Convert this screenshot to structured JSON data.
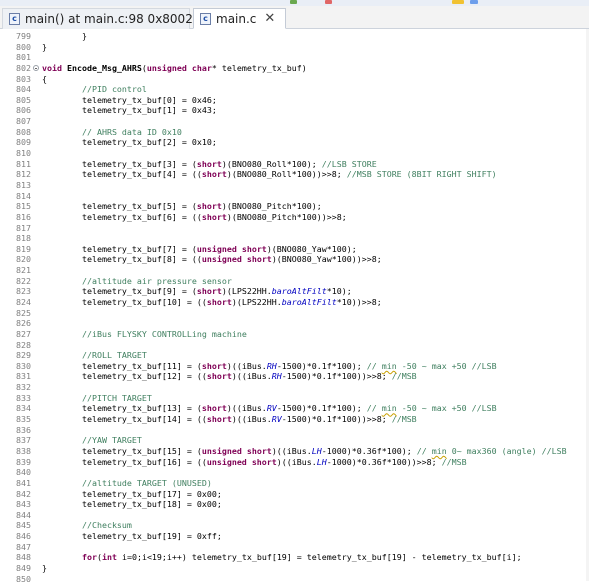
{
  "tabs": [
    {
      "label": "main() at main.c:98 0x8002222",
      "icon": "c-source-file-icon",
      "icon_text": "c",
      "active": false
    },
    {
      "label": "main.c",
      "icon": "c-source-file-icon",
      "icon_text": "c",
      "active": true,
      "close": "✕"
    }
  ],
  "editor": {
    "lines": [
      {
        "n": "799",
        "segs": [
          {
            "t": "        }"
          }
        ]
      },
      {
        "n": "800",
        "segs": [
          {
            "t": "}"
          }
        ]
      },
      {
        "n": "801",
        "segs": []
      },
      {
        "n": "802",
        "fold": true,
        "segs": [
          {
            "t": "void",
            "c": "kw"
          },
          {
            "t": " "
          },
          {
            "t": "Encode_Msg_AHRS",
            "c": "fnb"
          },
          {
            "t": "("
          },
          {
            "t": "unsigned",
            "c": "kw"
          },
          {
            "t": " "
          },
          {
            "t": "char",
            "c": "kw"
          },
          {
            "t": "* telemetry_tx_buf)"
          }
        ]
      },
      {
        "n": "803",
        "segs": [
          {
            "t": "{"
          }
        ]
      },
      {
        "n": "804",
        "segs": [
          {
            "t": "        "
          },
          {
            "t": "//PID control",
            "c": "cm"
          }
        ]
      },
      {
        "n": "805",
        "segs": [
          {
            "t": "        telemetry_tx_buf[0] = 0x46;"
          }
        ]
      },
      {
        "n": "806",
        "segs": [
          {
            "t": "        telemetry_tx_buf[1] = 0x43;"
          }
        ]
      },
      {
        "n": "807",
        "segs": []
      },
      {
        "n": "808",
        "segs": [
          {
            "t": "        "
          },
          {
            "t": "// AHRS data ID 0x10",
            "c": "cm"
          }
        ]
      },
      {
        "n": "809",
        "segs": [
          {
            "t": "        telemetry_tx_buf[2] = 0x10;"
          }
        ]
      },
      {
        "n": "810",
        "segs": []
      },
      {
        "n": "811",
        "segs": [
          {
            "t": "        telemetry_tx_buf[3] = ("
          },
          {
            "t": "short",
            "c": "kw"
          },
          {
            "t": ")(BNO080_Roll*100); "
          },
          {
            "t": "//LSB STORE",
            "c": "cm"
          }
        ]
      },
      {
        "n": "812",
        "segs": [
          {
            "t": "        telemetry_tx_buf[4] = (("
          },
          {
            "t": "short",
            "c": "kw"
          },
          {
            "t": ")(BNO080_Roll*100))>>8; "
          },
          {
            "t": "//MSB STORE (8BIT RIGHT SHIFT)",
            "c": "cm"
          }
        ]
      },
      {
        "n": "813",
        "segs": []
      },
      {
        "n": "814",
        "segs": []
      },
      {
        "n": "815",
        "segs": [
          {
            "t": "        telemetry_tx_buf[5] = ("
          },
          {
            "t": "short",
            "c": "kw"
          },
          {
            "t": ")(BNO080_Pitch*100);"
          }
        ]
      },
      {
        "n": "816",
        "segs": [
          {
            "t": "        telemetry_tx_buf[6] = (("
          },
          {
            "t": "short",
            "c": "kw"
          },
          {
            "t": ")(BNO080_Pitch*100))>>8;"
          }
        ]
      },
      {
        "n": "817",
        "segs": []
      },
      {
        "n": "818",
        "segs": []
      },
      {
        "n": "819",
        "segs": [
          {
            "t": "        telemetry_tx_buf[7] = ("
          },
          {
            "t": "unsigned",
            "c": "kw"
          },
          {
            "t": " "
          },
          {
            "t": "short",
            "c": "kw"
          },
          {
            "t": ")(BNO080_Yaw*100);"
          }
        ]
      },
      {
        "n": "820",
        "segs": [
          {
            "t": "        telemetry_tx_buf[8] = (("
          },
          {
            "t": "unsigned",
            "c": "kw"
          },
          {
            "t": " "
          },
          {
            "t": "short",
            "c": "kw"
          },
          {
            "t": ")(BNO080_Yaw*100))>>8;"
          }
        ]
      },
      {
        "n": "821",
        "segs": []
      },
      {
        "n": "822",
        "segs": [
          {
            "t": "        "
          },
          {
            "t": "//altitude air pressure sensor",
            "c": "cm"
          }
        ]
      },
      {
        "n": "823",
        "segs": [
          {
            "t": "        telemetry_tx_buf[9] = ("
          },
          {
            "t": "short",
            "c": "kw"
          },
          {
            "t": ")(LPS22HH."
          },
          {
            "t": "baroAltFilt",
            "c": "fd"
          },
          {
            "t": "*10);"
          }
        ]
      },
      {
        "n": "824",
        "segs": [
          {
            "t": "        telemetry_tx_buf[10] = (("
          },
          {
            "t": "short",
            "c": "kw"
          },
          {
            "t": ")(LPS22HH."
          },
          {
            "t": "baroAltFilt",
            "c": "fd"
          },
          {
            "t": "*10))>>8;"
          }
        ]
      },
      {
        "n": "825",
        "segs": []
      },
      {
        "n": "826",
        "segs": []
      },
      {
        "n": "827",
        "segs": [
          {
            "t": "        "
          },
          {
            "t": "//iBus FLYSKY CONTROLLing machine",
            "c": "cm"
          }
        ]
      },
      {
        "n": "828",
        "segs": []
      },
      {
        "n": "829",
        "segs": [
          {
            "t": "        "
          },
          {
            "t": "//ROLL TARGET",
            "c": "cm"
          }
        ]
      },
      {
        "n": "830",
        "segs": [
          {
            "t": "        telemetry_tx_buf[11] = ("
          },
          {
            "t": "short",
            "c": "kw"
          },
          {
            "t": ")((iBus."
          },
          {
            "t": "RH",
            "c": "fd"
          },
          {
            "t": "-1500)*0.1f*100); "
          },
          {
            "t": "// ",
            "c": "cm"
          },
          {
            "t": "min",
            "c": "cm sq"
          },
          {
            "t": " -50 ~ max +50 //LSB",
            "c": "cm"
          }
        ]
      },
      {
        "n": "831",
        "segs": [
          {
            "t": "        telemetry_tx_buf[12] = (("
          },
          {
            "t": "short",
            "c": "kw"
          },
          {
            "t": ")((iBus."
          },
          {
            "t": "RH",
            "c": "fd"
          },
          {
            "t": "-1500)*0.1f*100))>>8; "
          },
          {
            "t": "//MSB",
            "c": "cm"
          }
        ]
      },
      {
        "n": "832",
        "segs": []
      },
      {
        "n": "833",
        "segs": [
          {
            "t": "        "
          },
          {
            "t": "//PITCH TARGET",
            "c": "cm"
          }
        ]
      },
      {
        "n": "834",
        "segs": [
          {
            "t": "        telemetry_tx_buf[13] = ("
          },
          {
            "t": "short",
            "c": "kw"
          },
          {
            "t": ")((iBus."
          },
          {
            "t": "RV",
            "c": "fd"
          },
          {
            "t": "-1500)*0.1f*100); "
          },
          {
            "t": "// ",
            "c": "cm"
          },
          {
            "t": "min",
            "c": "cm sq"
          },
          {
            "t": " -50 ~ max +50 //LSB",
            "c": "cm"
          }
        ]
      },
      {
        "n": "835",
        "segs": [
          {
            "t": "        telemetry_tx_buf[14] = (("
          },
          {
            "t": "short",
            "c": "kw"
          },
          {
            "t": ")((iBus."
          },
          {
            "t": "RV",
            "c": "fd"
          },
          {
            "t": "-1500)*0.1f*100))>>8; "
          },
          {
            "t": "//MSB",
            "c": "cm"
          }
        ]
      },
      {
        "n": "836",
        "segs": []
      },
      {
        "n": "837",
        "segs": [
          {
            "t": "        "
          },
          {
            "t": "//YAW TARGET",
            "c": "cm"
          }
        ]
      },
      {
        "n": "838",
        "segs": [
          {
            "t": "        telemetry_tx_buf[15] = ("
          },
          {
            "t": "unsigned",
            "c": "kw"
          },
          {
            "t": " "
          },
          {
            "t": "short",
            "c": "kw"
          },
          {
            "t": ")((iBus."
          },
          {
            "t": "LH",
            "c": "fd"
          },
          {
            "t": "-1000)*0.36f*100); "
          },
          {
            "t": "// ",
            "c": "cm"
          },
          {
            "t": "min",
            "c": "cm sq"
          },
          {
            "t": " 0~ max360 (angle) //LSB",
            "c": "cm"
          }
        ]
      },
      {
        "n": "839",
        "segs": [
          {
            "t": "        telemetry_tx_buf[16] = (("
          },
          {
            "t": "unsigned",
            "c": "kw"
          },
          {
            "t": " "
          },
          {
            "t": "short",
            "c": "kw"
          },
          {
            "t": ")((iBus."
          },
          {
            "t": "LH",
            "c": "fd"
          },
          {
            "t": "-1000)*0.36f*100))>>8; "
          },
          {
            "t": "//MSB",
            "c": "cm"
          }
        ]
      },
      {
        "n": "840",
        "segs": []
      },
      {
        "n": "841",
        "segs": [
          {
            "t": "        "
          },
          {
            "t": "//altitude TARGET (UNUSED)",
            "c": "cm"
          }
        ]
      },
      {
        "n": "842",
        "segs": [
          {
            "t": "        telemetry_tx_buf[17] = 0x00;"
          }
        ]
      },
      {
        "n": "843",
        "segs": [
          {
            "t": "        telemetry_tx_buf[18] = 0x00;"
          }
        ]
      },
      {
        "n": "844",
        "segs": []
      },
      {
        "n": "845",
        "segs": [
          {
            "t": "        "
          },
          {
            "t": "//Checksum",
            "c": "cm"
          }
        ]
      },
      {
        "n": "846",
        "segs": [
          {
            "t": "        telemetry_tx_buf[19] = 0xff;"
          }
        ]
      },
      {
        "n": "847",
        "segs": []
      },
      {
        "n": "848",
        "segs": [
          {
            "t": "        "
          },
          {
            "t": "for",
            "c": "kw"
          },
          {
            "t": "("
          },
          {
            "t": "int",
            "c": "kw"
          },
          {
            "t": " i=0;i<19;i++) telemetry_tx_buf[19] = telemetry_tx_buf[19] - telemetry_tx_buf[i];"
          }
        ]
      },
      {
        "n": "849",
        "segs": [
          {
            "t": "}"
          }
        ]
      },
      {
        "n": "850",
        "segs": []
      }
    ]
  }
}
